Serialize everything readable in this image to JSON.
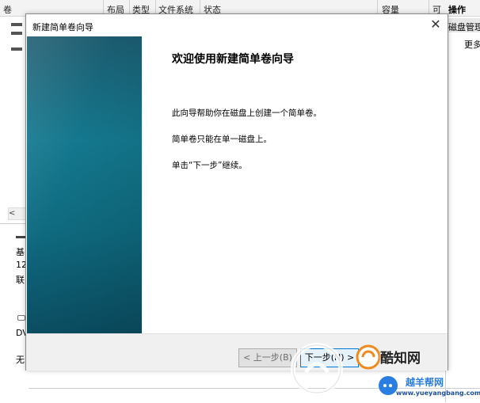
{
  "background": {
    "columns": [
      "卷",
      "布局",
      "类型",
      "文件系统",
      "状态",
      "容量",
      "可"
    ],
    "actions_header": "操作",
    "actions_items": [
      "磁盘管理",
      "更多"
    ],
    "disk_info": [
      "基",
      "12",
      "联"
    ],
    "dvd_label": "DV",
    "dvd_status": "无"
  },
  "wizard": {
    "title": "新建简单卷向导",
    "close_glyph": "✕",
    "heading": "欢迎使用新建简单卷向导",
    "paragraphs": [
      "此向导帮助你在磁盘上创建一个简单卷。",
      "简单卷只能在单一磁盘上。",
      "单击“下一步”继续。"
    ],
    "buttons": {
      "back": "< 上一步(B)",
      "next": "下一步(N) >"
    }
  },
  "watermark": {
    "brand": "酷知网",
    "site": "www.yueyangbang.com",
    "brand2": "越羊帮网"
  },
  "colors": {
    "side_panel": "#14788e",
    "primary_border": "#0078d7",
    "watermark_orange": "#f08a1c",
    "watermark_blue": "#2a7de1"
  }
}
